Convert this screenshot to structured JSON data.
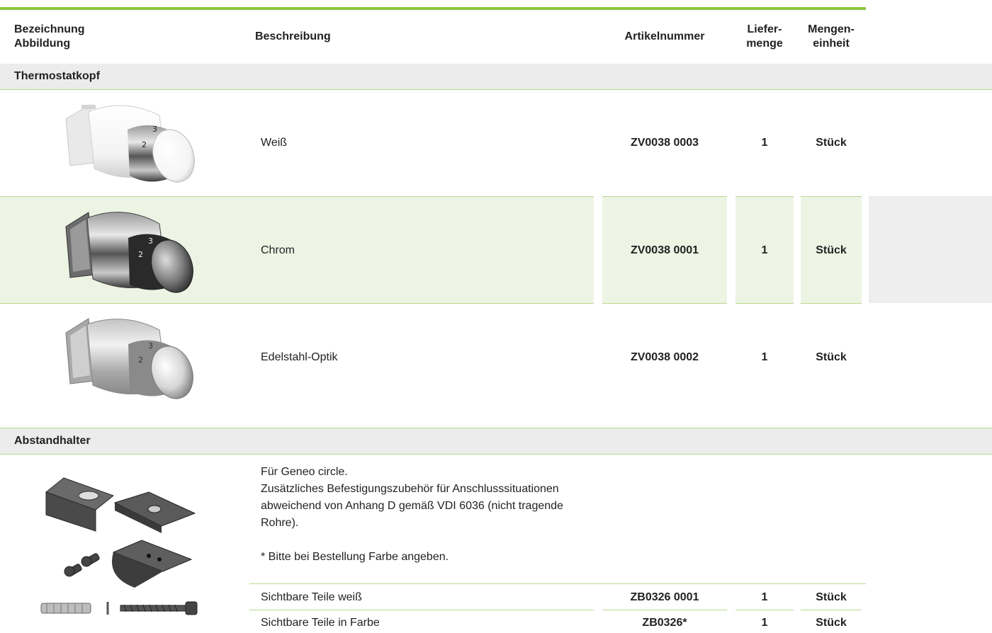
{
  "header": {
    "col1_line1": "Bezeichnung",
    "col1_line2": "Abbildung",
    "col2": "Beschreibung",
    "col3": "Artikelnummer",
    "col4_line1": "Liefer-",
    "col4_line2": "menge",
    "col5_line1": "Mengen-",
    "col5_line2": "einheit"
  },
  "sections": [
    {
      "title": "Thermostatkopf",
      "rows": [
        {
          "description": "Weiß",
          "article": "ZV0038 0003",
          "qty": "1",
          "unit": "Stück",
          "icon": "thermostat-white-icon"
        },
        {
          "description": "Chrom",
          "article": "ZV0038 0001",
          "qty": "1",
          "unit": "Stück",
          "icon": "thermostat-chrome-icon"
        },
        {
          "description": "Edelstahl-Optik",
          "article": "ZV0038 0002",
          "qty": "1",
          "unit": "Stück",
          "icon": "thermostat-steel-icon"
        }
      ]
    },
    {
      "title": "Abstandhalter",
      "description_lines": [
        "Für Geneo circle.",
        "Zusätzliches Befestigungszubehör für Anschlusssituationen abweichend von Anhang D gemäß VDI 6036 (nicht tragende Rohre).",
        "* Bitte bei Bestellung Farbe angeben."
      ],
      "icon": "bracket-set-icon",
      "rows": [
        {
          "description": "Sichtbare Teile weiß",
          "article": "ZB0326 0001",
          "qty": "1",
          "unit": "Stück"
        },
        {
          "description": "Sichtbare Teile in Farbe",
          "article": "ZB0326*",
          "qty": "1",
          "unit": "Stück"
        }
      ]
    }
  ],
  "colors": {
    "accent": "#8cc63f",
    "band": "#eef4e4",
    "section": "#ececec"
  }
}
